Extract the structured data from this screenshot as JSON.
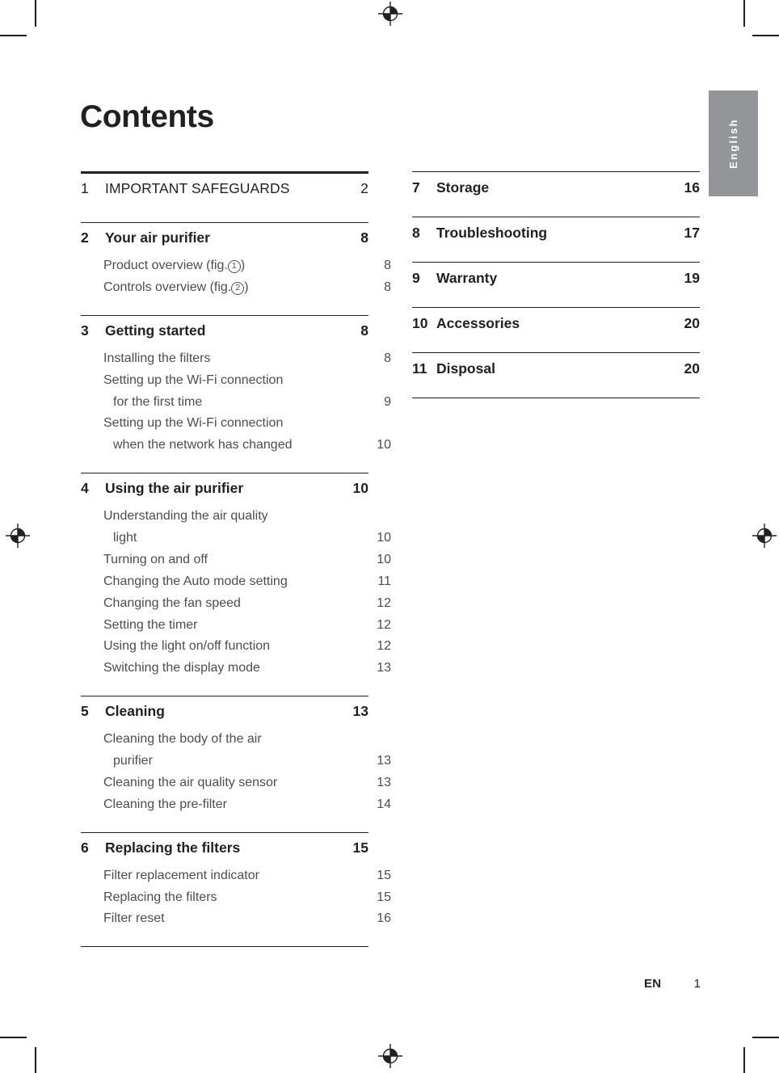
{
  "page": {
    "title": "Contents",
    "language_tab": "English",
    "footer_locale": "EN",
    "footer_page_number": "1",
    "accent_gray": "#939598",
    "text_color": "#231f20",
    "sub_text_color": "#4d4d4f"
  },
  "toc": {
    "left_column": [
      {
        "number": "1",
        "label": "IMPORTANT SAFEGUARDS",
        "page": "2",
        "style": "caps",
        "rule": "thick",
        "children": []
      },
      {
        "number": "2",
        "label": "Your air purifier",
        "page": "8",
        "rule": "thin",
        "children": [
          {
            "label_pre": "Product overview (fig.",
            "circled": "1",
            "label_post": ")",
            "page": "8"
          },
          {
            "label_pre": "Controls overview (fig.",
            "circled": "2",
            "label_post": ")",
            "page": "8"
          }
        ]
      },
      {
        "number": "3",
        "label": "Getting started",
        "page": "8",
        "rule": "thin",
        "children": [
          {
            "label": "Installing the filters",
            "page": "8"
          },
          {
            "label": "Setting up the Wi-Fi connection",
            "page": ""
          },
          {
            "label": "for the first time",
            "page": "9",
            "continuation": true
          },
          {
            "label": "Setting up the Wi-Fi connection",
            "page": ""
          },
          {
            "label": "when the network has changed",
            "page": "10",
            "continuation": true
          }
        ]
      },
      {
        "number": "4",
        "label": "Using the air purifier",
        "page": "10",
        "rule": "thin",
        "children": [
          {
            "label": "Understanding the air quality",
            "page": ""
          },
          {
            "label": "light",
            "page": "10",
            "continuation": true
          },
          {
            "label": "Turning on and off",
            "page": "10"
          },
          {
            "label": "Changing the Auto mode setting",
            "page": "11"
          },
          {
            "label": "Changing the fan speed",
            "page": "12"
          },
          {
            "label": "Setting the timer",
            "page": "12"
          },
          {
            "label": "Using the light on/off function",
            "page": "12"
          },
          {
            "label": "Switching the display mode",
            "page": "13"
          }
        ]
      },
      {
        "number": "5",
        "label": "Cleaning",
        "page": "13",
        "rule": "thin",
        "children": [
          {
            "label": "Cleaning the body of the air",
            "page": ""
          },
          {
            "label": "purifier",
            "page": "13",
            "continuation": true
          },
          {
            "label": "Cleaning the air quality sensor",
            "page": "13"
          },
          {
            "label": "Cleaning the pre-filter",
            "page": "14"
          }
        ]
      },
      {
        "number": "6",
        "label": "Replacing the filters",
        "page": "15",
        "rule": "thin",
        "children": [
          {
            "label": "Filter replacement indicator",
            "page": "15"
          },
          {
            "label": "Replacing the filters",
            "page": "15"
          },
          {
            "label": "Filter reset",
            "page": "16"
          }
        ]
      }
    ],
    "right_column": [
      {
        "number": "7",
        "label": "Storage",
        "page": "16",
        "rule": "thin",
        "children": []
      },
      {
        "number": "8",
        "label": "Troubleshooting",
        "page": "17",
        "rule": "thin",
        "children": []
      },
      {
        "number": "9",
        "label": "Warranty",
        "page": "19",
        "rule": "thin",
        "children": []
      },
      {
        "number": "10",
        "label": "Accessories",
        "page": "20",
        "rule": "thin",
        "children": []
      },
      {
        "number": "11",
        "label": "Disposal",
        "page": "20",
        "rule": "thin",
        "children": []
      }
    ]
  }
}
